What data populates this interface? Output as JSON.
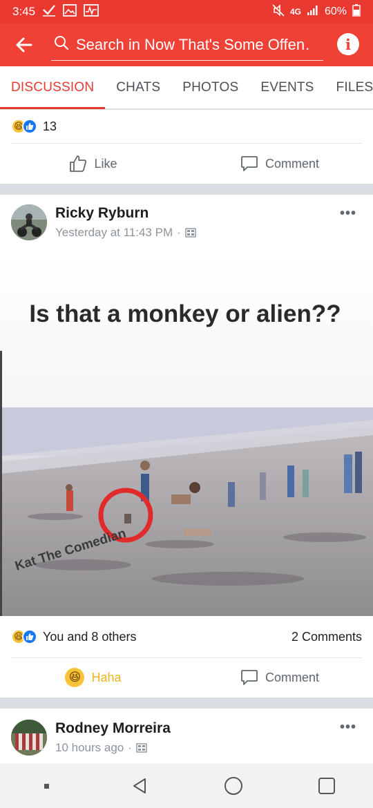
{
  "status_bar": {
    "time": "3:45",
    "network": "4G",
    "battery": "60%"
  },
  "app_bar": {
    "search_placeholder": "Search in Now That's Some Offen…",
    "info_label": "i"
  },
  "tabs": [
    {
      "label": "DISCUSSION",
      "active": true
    },
    {
      "label": "CHATS",
      "active": false
    },
    {
      "label": "PHOTOS",
      "active": false
    },
    {
      "label": "EVENTS",
      "active": false
    },
    {
      "label": "FILES",
      "active": false
    }
  ],
  "prev_post": {
    "reaction_count": "13",
    "like_label": "Like",
    "comment_label": "Comment"
  },
  "post": {
    "author": "Ricky Ryburn",
    "timestamp": "Yesterday at 11:43 PM",
    "more_label": "•••",
    "image_caption": "Is that a monkey or alien??",
    "watermark": "Kat The Comedian",
    "reactions_text": "You and 8 others",
    "comments_count": "2 Comments",
    "haha_label": "Haha",
    "comment_label": "Comment",
    "colors": {
      "haha": "#f0b41c",
      "accent": "#ef4136",
      "like_blue": "#1877f2"
    }
  },
  "next_post": {
    "author": "Rodney Morreira",
    "timestamp": "10 hours ago",
    "more_label": "•••"
  },
  "nav_bar": {
    "icons": [
      "recent-apps-dot-icon",
      "back-triangle-icon",
      "home-circle-icon",
      "overview-square-icon"
    ]
  }
}
